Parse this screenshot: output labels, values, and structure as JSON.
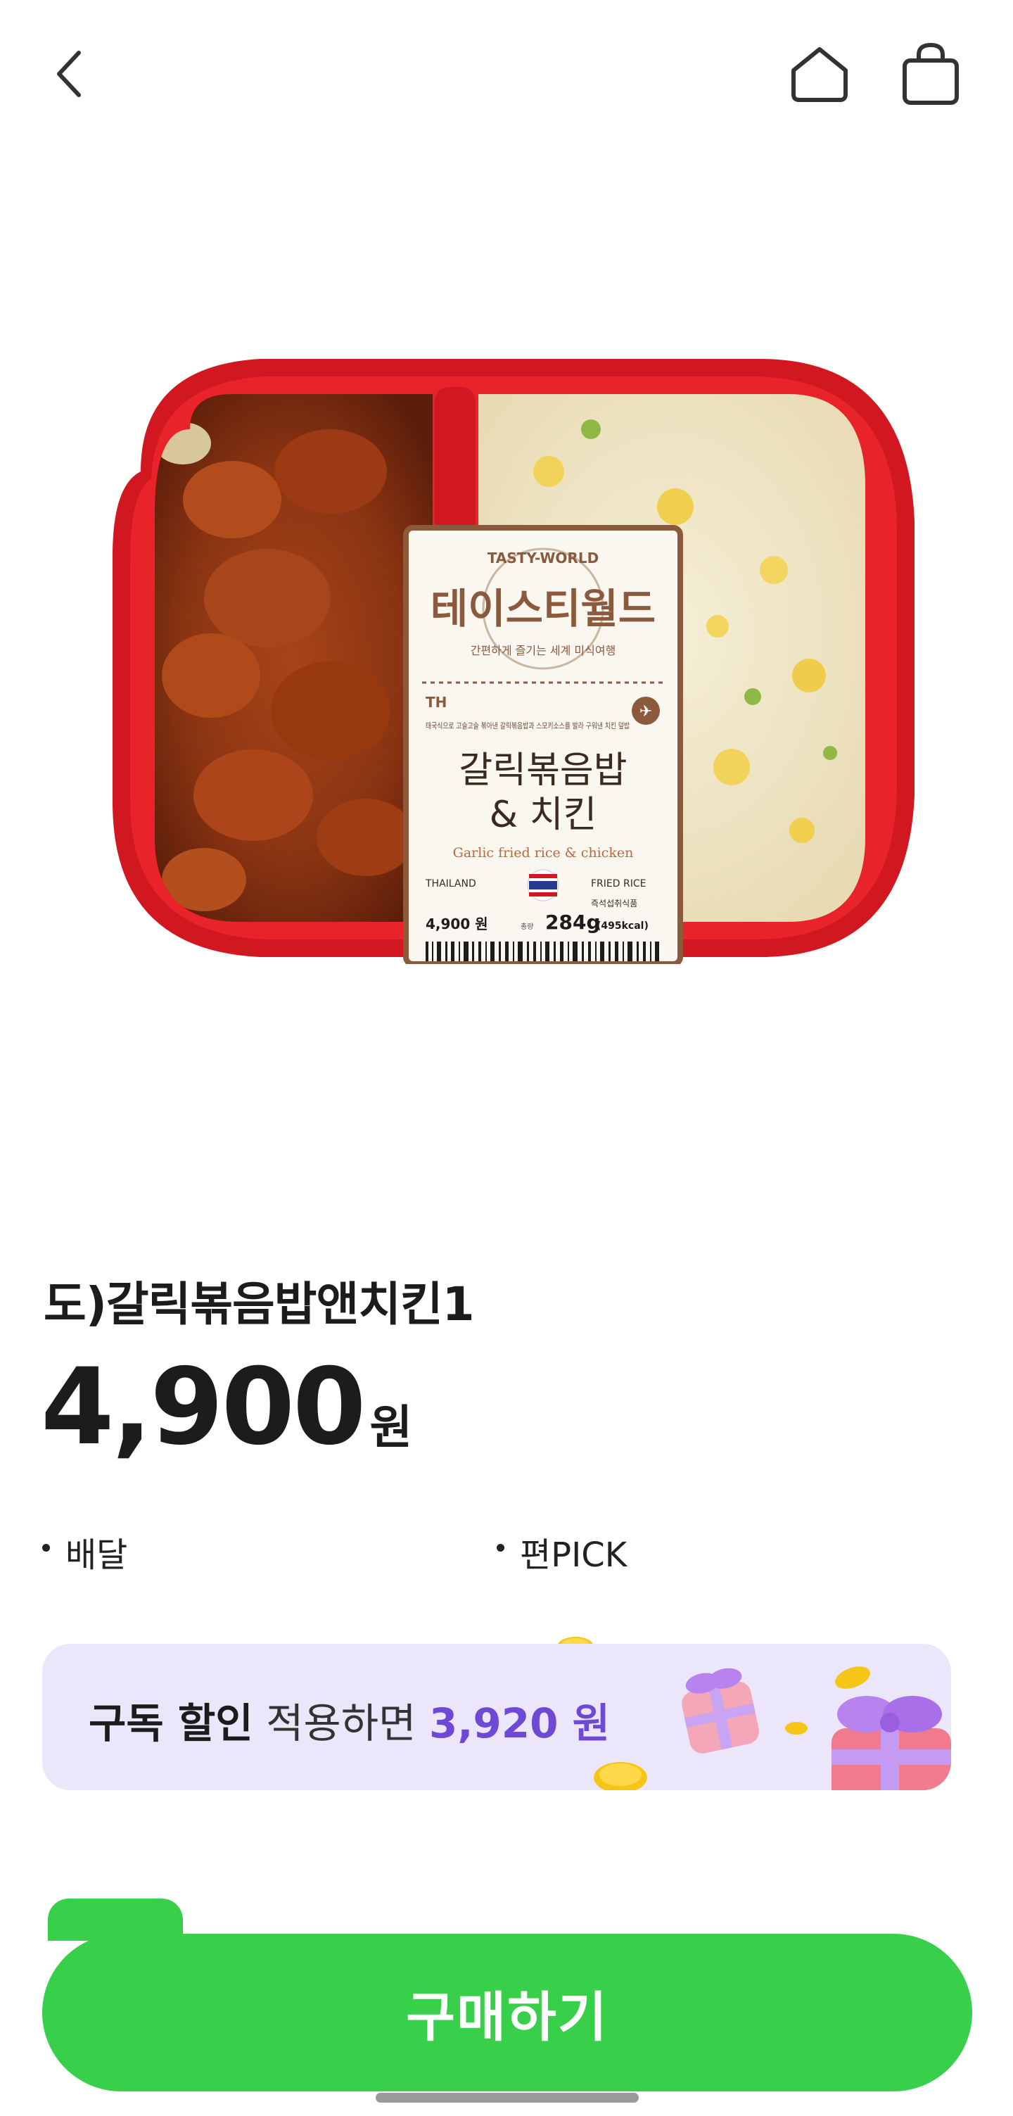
{
  "header": {
    "back_icon": "chevron-left-icon",
    "home_icon": "home-icon",
    "cart_icon": "shopping-bag-icon"
  },
  "product": {
    "title": "도)갈릭볶음밥앤치킨1",
    "price": "4,900",
    "price_unit": "원",
    "tags": [
      "배달",
      "편PICK"
    ],
    "package": {
      "brand_en": "TASTY-WORLD",
      "brand_ko": "테이스티월드",
      "brand_tagline": "간편하게 즐기는 세계 미식여행",
      "country_code": "TH",
      "description": "태국식으로 고슬고슬 볶아낸 갈릭볶음밥과 스모키소스를 발라 구워낸 치킨 덮밥",
      "name_line1": "갈릭볶음밥",
      "name_line2": "& 치킨",
      "name_en": "Garlic fried rice & chicken",
      "country_label": "THAILAND",
      "category_label": "FRIED RICE",
      "type_label": "즉석섭취식품",
      "pkg_price": "4,900 원",
      "weight_label": "총량",
      "weight": "284g",
      "kcal": "(495kcal)"
    }
  },
  "banner": {
    "strong": "구독 할인",
    "middle": " 적용하면 ",
    "amount": "3,920 원"
  },
  "actions": {
    "buy": "구매하기"
  },
  "colors": {
    "accent_green": "#38d04a",
    "banner_bg": "#ece6fb",
    "banner_amount": "#7048d6",
    "tray_red": "#e11f26",
    "label_brown": "#8b5a3c"
  }
}
